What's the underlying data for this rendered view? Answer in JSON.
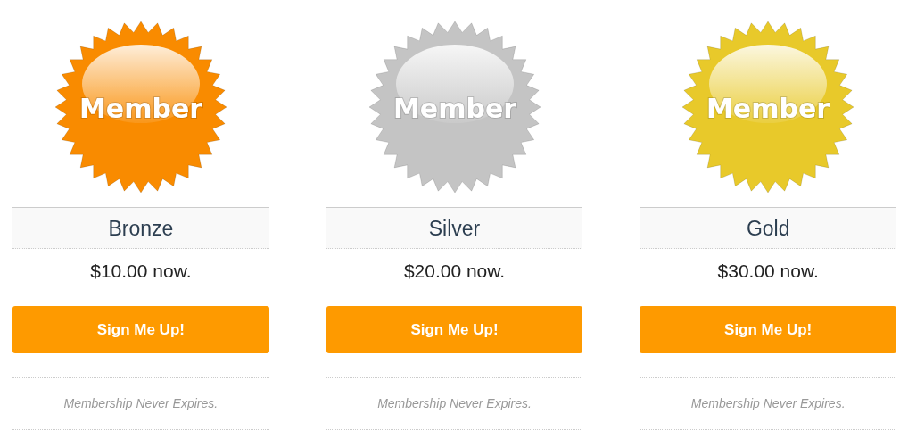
{
  "plans": [
    {
      "badge_text": "Member",
      "color": "#f98b00",
      "name": "Bronze",
      "price": "$10.00 now.",
      "button": "Sign Me Up!",
      "note": "Membership Never Expires."
    },
    {
      "badge_text": "Member",
      "color": "#c4c4c4",
      "name": "Silver",
      "price": "$20.00 now.",
      "button": "Sign Me Up!",
      "note": "Membership Never Expires."
    },
    {
      "badge_text": "Member",
      "color": "#e8c92a",
      "name": "Gold",
      "price": "$30.00 now.",
      "button": "Sign Me Up!",
      "note": "Membership Never Expires."
    }
  ]
}
